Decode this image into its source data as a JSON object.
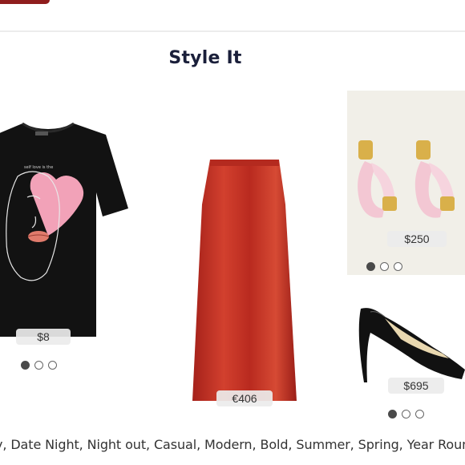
{
  "section": {
    "title": "Style It"
  },
  "products": [
    {
      "name": "graphic-tee",
      "price": "$8",
      "dots": 3,
      "active_dot": 0
    },
    {
      "name": "satin-skirt",
      "price": "€406",
      "dots": 0,
      "active_dot": -1
    },
    {
      "name": "hoop-earrings",
      "price": "$250",
      "dots": 3,
      "active_dot": 0
    },
    {
      "name": "patent-pumps",
      "price": "$695",
      "dots": 3,
      "active_dot": 0
    }
  ],
  "tags_line": "y, Date Night, Night out, Casual, Modern, Bold, Summer, Spring, Year Round",
  "colors": {
    "title": "#1a1f3a",
    "skirt": "#c0281d",
    "accent": "#8f1d1d"
  }
}
